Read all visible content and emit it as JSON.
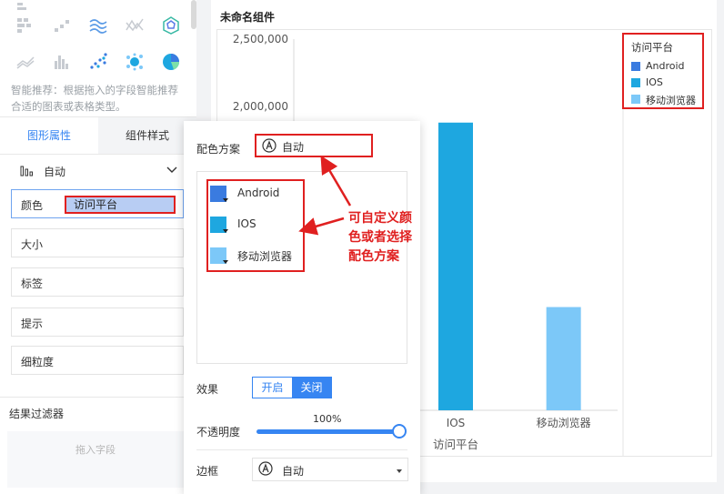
{
  "left_panel": {
    "recommend_text": "智能推荐：根据拖入的字段智能推荐合适的图表或表格类型。",
    "tabs": [
      "图形属性",
      "组件样式"
    ],
    "chart_type_label": "自动",
    "rows": {
      "color": "颜色",
      "color_field": "访问平台",
      "size": "大小",
      "label": "标签",
      "tooltip": "提示",
      "granularity": "细粒度"
    },
    "filter_title": "结果过滤器",
    "filter_placeholder": "拖入字段",
    "gallery_icons": [
      "stacked-bar-icon",
      "scatter-small-icon",
      "multi-line-icon",
      "broken-line-icon",
      "radar-icon",
      "area-line-icon",
      "bar-group-icon",
      "dot-scatter-icon",
      "bubble-icon",
      "pie-icon"
    ]
  },
  "widget": {
    "title": "未命名组件"
  },
  "chart_data": {
    "type": "bar",
    "categories": [
      "Android",
      "IOS",
      "移动浏览器"
    ],
    "xlabel": "访问平台",
    "ylabel": "",
    "ylim": [
      0,
      2500000
    ],
    "yticks": [
      "2,500,000",
      "2,000,000"
    ],
    "series": [
      {
        "name": "Android",
        "values": [
          null,
          null,
          null
        ],
        "color": "#3a7be0"
      },
      {
        "name": "IOS",
        "values": [
          null,
          1880000,
          null
        ],
        "color": "#1ea7e0"
      },
      {
        "name": "移动浏览器",
        "values": [
          null,
          null,
          510000
        ],
        "color": "#7cc8f8"
      }
    ],
    "legend_title": "访问平台",
    "legend_position": "top-right",
    "visible_x_labels": [
      "IOS",
      "移动浏览器"
    ]
  },
  "popup": {
    "scheme_label": "配色方案",
    "scheme_value": "自动",
    "swatches": [
      {
        "name": "Android",
        "color": "#3a7be0"
      },
      {
        "name": "IOS",
        "color": "#1ea7e0"
      },
      {
        "name": "移动浏览器",
        "color": "#7cc8f8"
      }
    ],
    "effect_label": "效果",
    "effect_on": "开启",
    "effect_off": "关闭",
    "opacity_label": "不透明度",
    "opacity_value": "100%",
    "border_label": "边框",
    "border_value": "自动"
  },
  "annotation": {
    "text": "可自定义颜色或者选择配色方案"
  },
  "colors": {
    "accent": "#3685f2",
    "highlight_red": "#e02020"
  }
}
